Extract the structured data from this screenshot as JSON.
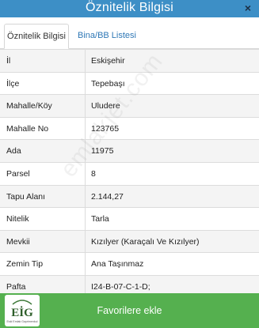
{
  "dialog": {
    "title": "Öznitelik Bilgisi",
    "close_label": "×"
  },
  "tabs": [
    {
      "label": "Öznitelik Bilgisi",
      "active": true
    },
    {
      "label": "Bina/BB Listesi",
      "active": false
    }
  ],
  "rows": [
    {
      "label": "İl",
      "value": "Eskişehir"
    },
    {
      "label": "İlçe",
      "value": "Tepebaşı"
    },
    {
      "label": "Mahalle/Köy",
      "value": "Uludere"
    },
    {
      "label": "Mahalle No",
      "value": "123765"
    },
    {
      "label": "Ada",
      "value": "11975"
    },
    {
      "label": "Parsel",
      "value": "8"
    },
    {
      "label": "Tapu Alanı",
      "value": "2.144,27"
    },
    {
      "label": "Nitelik",
      "value": "Tarla"
    },
    {
      "label": "Mevkii",
      "value": "Kızılyer (Karaçalı Ve Kızılyer)"
    },
    {
      "label": "Zemin Tip",
      "value": "Ana Taşınmaz"
    },
    {
      "label": "Pafta",
      "value": "I24-B-07-C-1-D;"
    }
  ],
  "watermark": "emlakjet.com",
  "footer": {
    "favorite_label": "Favorilere ekle",
    "logo_text": "EİG",
    "logo_subtext": "Eski Emlak Gayrimenkul"
  },
  "colors": {
    "titlebar": "#3d8fc6",
    "favorite_button": "#55b04f",
    "tab_link": "#2f78b6",
    "logo_green": "#3f7a3a"
  }
}
